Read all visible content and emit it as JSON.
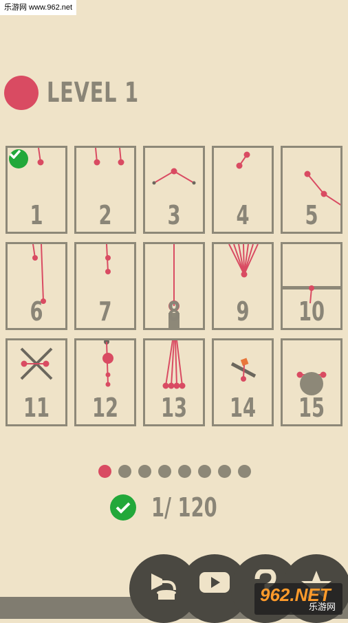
{
  "watermark_top": "乐游网 www.962.net",
  "header": {
    "title": "LEVEL 1",
    "accent": "#d94b62"
  },
  "levels": [
    {
      "num": "1",
      "completed": true
    },
    {
      "num": "2",
      "completed": false
    },
    {
      "num": "3",
      "completed": false
    },
    {
      "num": "4",
      "completed": false
    },
    {
      "num": "5",
      "completed": false
    },
    {
      "num": "6",
      "completed": false
    },
    {
      "num": "7",
      "completed": false
    },
    {
      "num": "8",
      "completed": false
    },
    {
      "num": "9",
      "completed": false
    },
    {
      "num": "10",
      "completed": false
    },
    {
      "num": "11",
      "completed": false
    },
    {
      "num": "12",
      "completed": false
    },
    {
      "num": "13",
      "completed": false
    },
    {
      "num": "14",
      "completed": false
    },
    {
      "num": "15",
      "completed": false
    }
  ],
  "pager": {
    "total": 8,
    "active": 1
  },
  "progress": {
    "text": "1/ 120"
  },
  "bottom_buttons": [
    "gramophone-icon",
    "youtube-icon",
    "help-icon",
    "star-icon"
  ],
  "watermark_bottom": {
    "brand": "962.NET",
    "sub": "乐游网"
  },
  "colors": {
    "background": "#efe3c8",
    "frame": "#8d8878",
    "rope": "#d94b62",
    "check": "#22a83a"
  }
}
